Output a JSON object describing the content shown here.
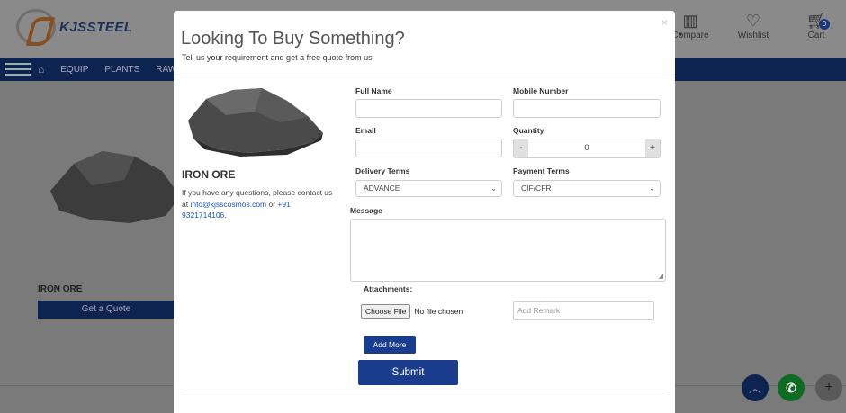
{
  "background": {
    "logo_text": "KJSSTEEL",
    "header_icons": [
      {
        "name": "compare",
        "label": "Compare"
      },
      {
        "name": "wishlist",
        "label": "Wishlist"
      },
      {
        "name": "cart",
        "label": "Cart",
        "badge": "0"
      }
    ],
    "nav": [
      "EQUIP",
      "PLANTS",
      "RAW"
    ],
    "product_label": "IRON ORE",
    "quote_button": "Get a Quote"
  },
  "modal": {
    "close": "×",
    "title": "Looking To Buy Something?",
    "subtitle": "Tell us your requirement and get a free quote from us",
    "product_name": "IRON ORE",
    "contact_prefix": "If you have any questions, please contact us at ",
    "contact_email": "info@kjsscosmos.com",
    "contact_or": " or ",
    "contact_phone": "+91 9321714106",
    "contact_suffix": ".",
    "fields": {
      "full_name_label": "Full Name",
      "mobile_label": "Mobile Number",
      "email_label": "Email",
      "quantity_label": "Quantity",
      "quantity_value": "0",
      "minus": "-",
      "plus": "+",
      "delivery_label": "Delivery Terms",
      "delivery_value": "ADVANCE",
      "payment_label": "Payment Terms",
      "payment_value": "CIF/CFR",
      "message_label": "Message",
      "attachments_label": "Attachments:",
      "choose_file": "Choose File",
      "no_file": "No file chosen",
      "remark_placeholder": "Add Remark"
    },
    "add_more": "Add More",
    "submit": "Submit"
  }
}
